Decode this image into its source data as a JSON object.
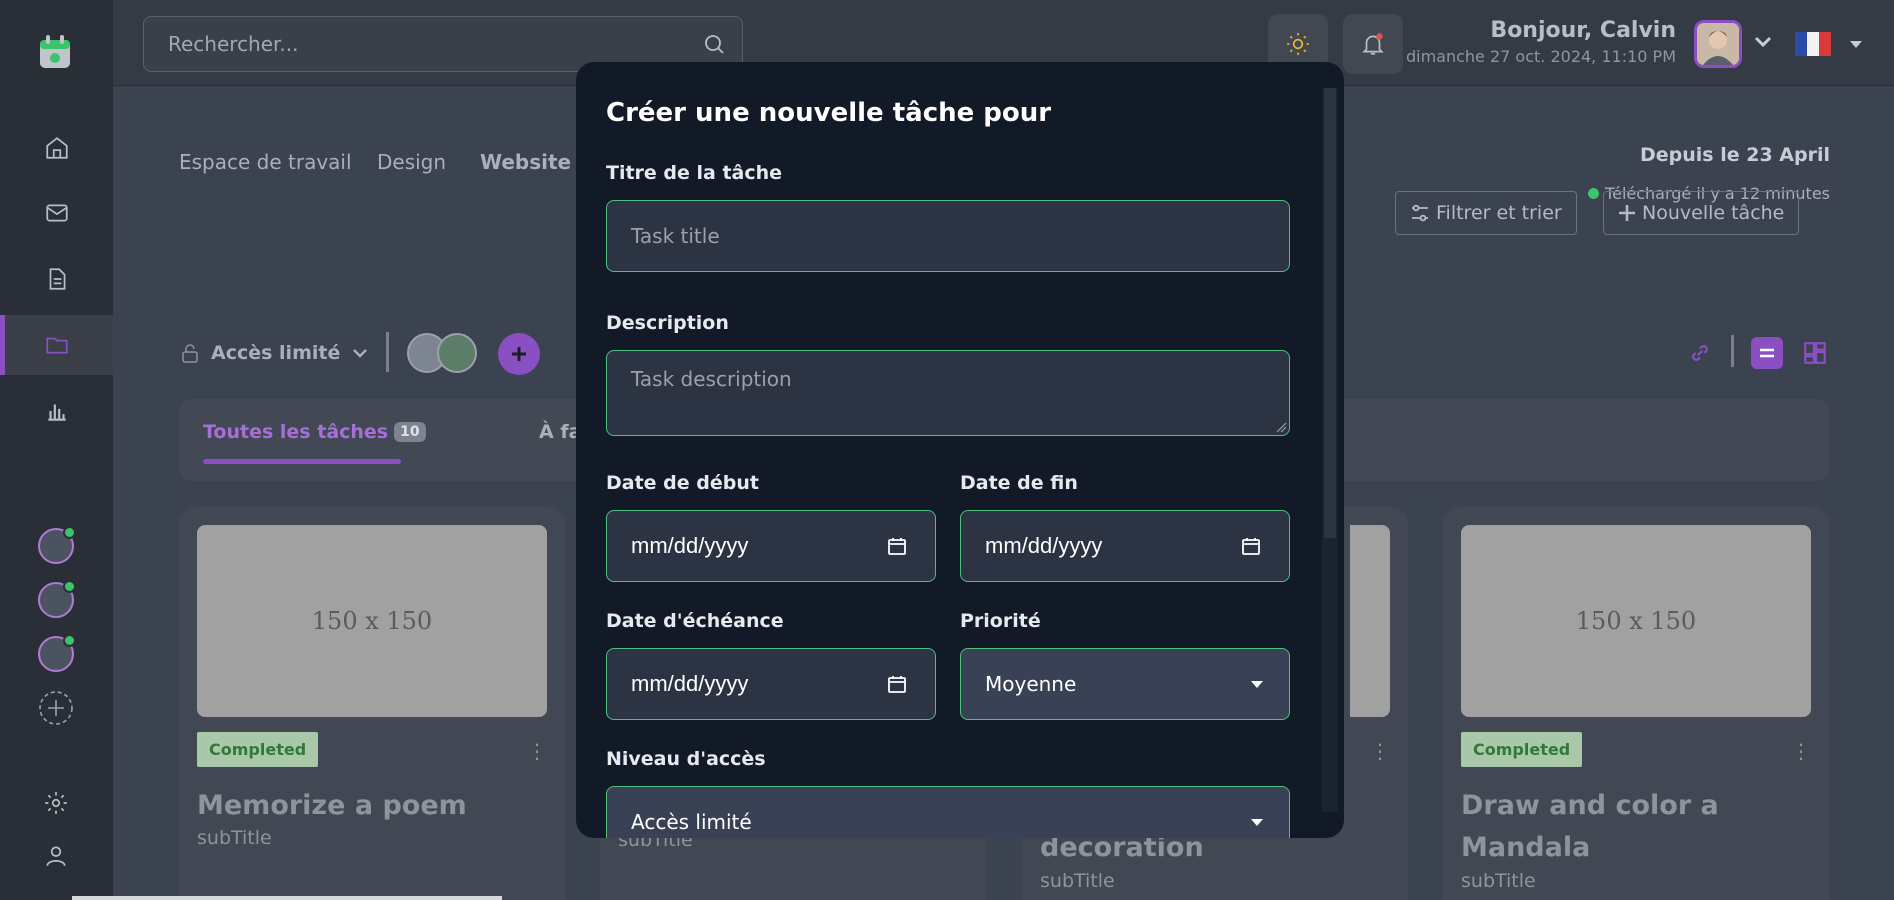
{
  "search": {
    "placeholder": "Rechercher..."
  },
  "user": {
    "greeting": "Bonjour, Calvin",
    "datetime": "dimanche 27 oct. 2024, 11:10 PM"
  },
  "breadcrumb": [
    "Espace de travail",
    "Design",
    "Website D"
  ],
  "project": {
    "since": "Depuis le 23 April",
    "uploaded": "Téléchargé il y a 12 minutes"
  },
  "access": {
    "label": "Accès limité"
  },
  "tabs": {
    "all_label": "Toutes les tâches",
    "all_count": "10",
    "todo_label": "À faire/En cours"
  },
  "toolbar": {
    "filter_label": "Filtrer et trier",
    "new_task_label": "Nouvelle tâche"
  },
  "cards": [
    {
      "thumb": "150 x 150",
      "status": "Completed",
      "title": "Memorize a poem",
      "subtitle": "subTitle"
    },
    {
      "thumb": "150 x 150",
      "status": "Completed",
      "title": "Draw and color a Mandala",
      "subtitle": "subTitle"
    }
  ],
  "partial_cards": {
    "title_fragment": "decoration",
    "subtitle_a": "subTitle",
    "subtitle_b": "subTitle"
  },
  "modal": {
    "title": "Créer une nouvelle tâche pour",
    "task_title_label": "Titre de la tâche",
    "task_title_placeholder": "Task title",
    "description_label": "Description",
    "description_placeholder": "Task description",
    "start_date_label": "Date de début",
    "end_date_label": "Date de fin",
    "due_date_label": "Date d'échéance",
    "priority_label": "Priorité",
    "date_placeholder": "mm/dd/yyyy",
    "priority_value": "Moyenne",
    "access_label": "Niveau d'accès",
    "access_value": "Accès limité"
  },
  "colors": {
    "accent": "#8b4fc4",
    "success": "#4fbf7c",
    "modal_bg": "#121a28"
  }
}
